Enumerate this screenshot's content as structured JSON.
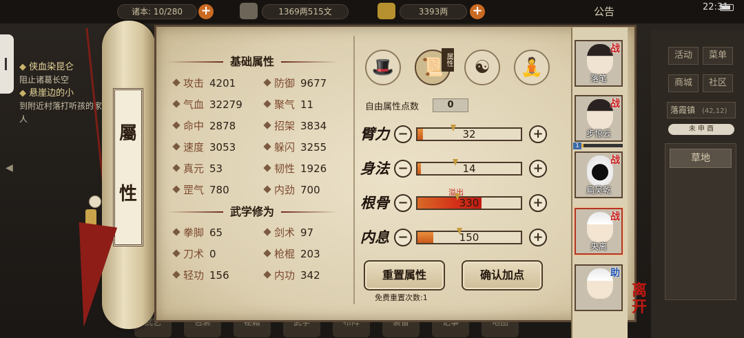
{
  "topbar": {
    "stamina": "诸本: 10/280",
    "copper": "1369两515文",
    "silver": "3393两",
    "announce": "公告",
    "clock": "22:31"
  },
  "quests": [
    {
      "title": "侠血染昆仑",
      "desc": "阻止诸葛长空"
    },
    {
      "title": "悬崖边的小",
      "desc": "到附近村落打听孩的家人"
    }
  ],
  "right_panel": {
    "buttons": [
      "活动",
      "菜单",
      "商城",
      "社区"
    ],
    "location": "落霞镇",
    "coords": "(42,12)",
    "time": "未 申 酉",
    "terrain": "草地"
  },
  "scroll_title": [
    "屬",
    "性"
  ],
  "basic": {
    "heading": "基础属性",
    "stats": [
      {
        "name": "攻击",
        "value": "4201"
      },
      {
        "name": "防御",
        "value": "9677"
      },
      {
        "name": "气血",
        "value": "32279"
      },
      {
        "name": "聚气",
        "value": "11"
      },
      {
        "name": "命中",
        "value": "2878"
      },
      {
        "name": "招架",
        "value": "3834"
      },
      {
        "name": "速度",
        "value": "3053"
      },
      {
        "name": "躲闪",
        "value": "3255"
      },
      {
        "name": "真元",
        "value": "53"
      },
      {
        "name": "韧性",
        "value": "1926"
      },
      {
        "name": "罡气",
        "value": "780"
      },
      {
        "name": "内劲",
        "value": "700"
      }
    ]
  },
  "martial": {
    "heading": "武学修为",
    "stats": [
      {
        "name": "拳脚",
        "value": "65"
      },
      {
        "name": "剑术",
        "value": "97"
      },
      {
        "name": "刀术",
        "value": "0"
      },
      {
        "name": "枪棍",
        "value": "203"
      },
      {
        "name": "轻功",
        "value": "156"
      },
      {
        "name": "内功",
        "value": "342"
      }
    ]
  },
  "tabs": [
    {
      "name": "equipment",
      "icon": "hat-icon",
      "glyph": "🎩"
    },
    {
      "name": "attributes",
      "icon": "scroll-book-icon",
      "glyph": "📜",
      "tag": "属性"
    },
    {
      "name": "meridian",
      "icon": "bagua-icon",
      "glyph": "☯"
    },
    {
      "name": "body",
      "icon": "body-figure-icon",
      "glyph": "🧘"
    }
  ],
  "free_points": {
    "label": "自由属性点数",
    "value": "0"
  },
  "attributes": [
    {
      "name": "臂力",
      "value": "32",
      "fill": 0.05
    },
    {
      "name": "身法",
      "value": "14",
      "fill": 0.03
    },
    {
      "name": "根骨",
      "value": "330",
      "fill": 0.62,
      "overflow": true
    },
    {
      "name": "内息",
      "value": "150",
      "fill": 0.15
    }
  ],
  "overflow_label": "溢出",
  "buttons": {
    "reset": "重置属性",
    "confirm": "确认加点",
    "free_reset": "免费重置次数:1"
  },
  "party": [
    {
      "name": "落笔",
      "role": "战",
      "style": "dark"
    },
    {
      "name": "步惊云",
      "role": "战",
      "style": "dark",
      "level": "1",
      "hp": 0.18
    },
    {
      "name": "扁吴乾",
      "role": "战",
      "style": "mask"
    },
    {
      "name": "央离",
      "role": "战",
      "style": "white",
      "selected": true
    },
    {
      "name": "",
      "role": "助",
      "style": "white",
      "assist": true
    }
  ],
  "leave": "离开",
  "bottom_menu": [
    "武艺",
    "包裹",
    "秘籍",
    "武学",
    "布阵",
    "装备",
    "记事",
    "地图"
  ]
}
